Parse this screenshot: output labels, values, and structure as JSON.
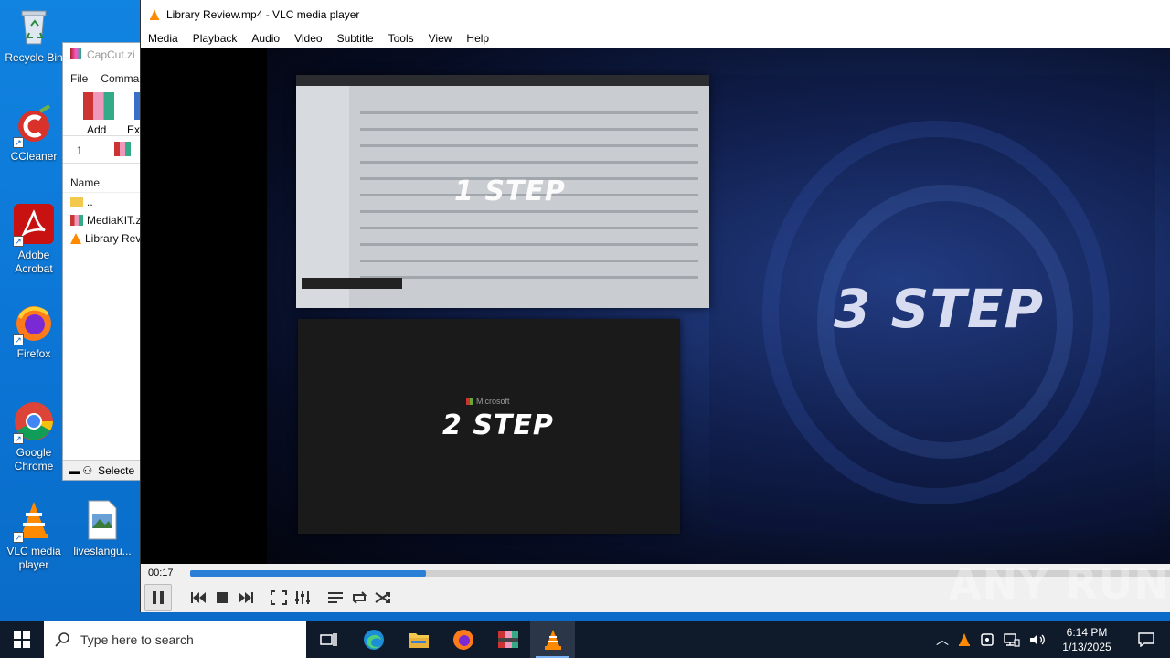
{
  "desktop": {
    "icons": [
      {
        "label": "Recycle Bin",
        "icon": "recycle-bin-icon"
      },
      {
        "label": "CCleaner",
        "icon": "ccleaner-icon"
      },
      {
        "label": "Adobe Acrobat",
        "icon": "acrobat-icon"
      },
      {
        "label": "Firefox",
        "icon": "firefox-icon"
      },
      {
        "label": "Google Chrome",
        "icon": "chrome-icon"
      },
      {
        "label": "VLC media player",
        "icon": "vlc-icon"
      },
      {
        "label": "liveslangu...",
        "icon": "image-file-icon"
      }
    ]
  },
  "winrar": {
    "title": "CapCut.zi",
    "menu": [
      "File",
      "Comma"
    ],
    "tools": [
      "Add",
      "Ex"
    ],
    "column": "Name",
    "rows": [
      "..",
      "MediaKIT.zi",
      "Library Revi"
    ],
    "status": "Selecte"
  },
  "vlc": {
    "title": "Library Review.mp4 - VLC media player",
    "menu": [
      "Media",
      "Playback",
      "Audio",
      "Video",
      "Subtitle",
      "Tools",
      "View",
      "Help"
    ],
    "video": {
      "step1": "1 STEP",
      "step2": "2 STEP",
      "step3": "3 STEP",
      "ms_logo_text": "Microsoft"
    },
    "time_elapsed": "00:17",
    "progress_fraction": 0.24
  },
  "watermark": "ANY RUN",
  "taskbar": {
    "search_placeholder": "Type here to search",
    "time": "6:14 PM",
    "date": "1/13/2025"
  },
  "colors": {
    "desktop": "#0b78d7",
    "taskbar": "#0f1b2a",
    "progress": "#2a7fd6"
  }
}
